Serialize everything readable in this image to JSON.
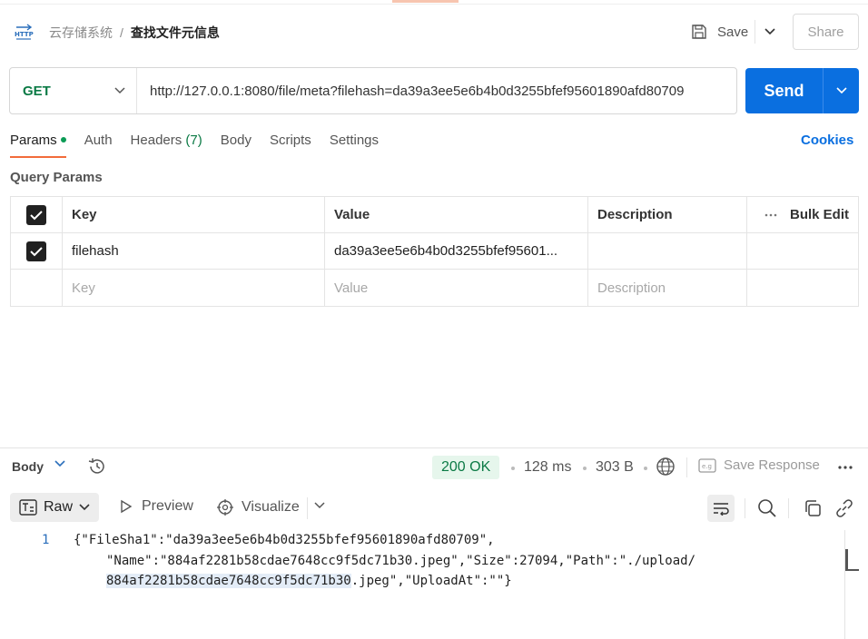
{
  "colors": {
    "accent": "#f26b3a",
    "send": "#0a6fe0",
    "get": "#0b7a45",
    "status_ok_bg": "#e6f6ec"
  },
  "header": {
    "icon": "http-icon",
    "breadcrumb_parent": "云存储系统",
    "breadcrumb_sep": "/",
    "title": "查找文件元信息",
    "save_label": "Save",
    "share_label": "Share"
  },
  "request": {
    "method": "GET",
    "url": "http://127.0.0.1:8080/file/meta?filehash=da39a3ee5e6b4b0d3255bfef95601890afd80709",
    "send_label": "Send"
  },
  "tabs": {
    "params": "Params",
    "auth": "Auth",
    "headers": "Headers",
    "headers_count": "(7)",
    "body": "Body",
    "scripts": "Scripts",
    "settings": "Settings",
    "cookies": "Cookies"
  },
  "query_params": {
    "title": "Query Params",
    "headers": {
      "key": "Key",
      "value": "Value",
      "description": "Description",
      "bulk_edit": "Bulk Edit"
    },
    "rows": [
      {
        "checked": true,
        "key": "filehash",
        "value": "da39a3ee5e6b4b0d3255bfef95601...",
        "description": ""
      }
    ],
    "placeholder": {
      "key": "Key",
      "value": "Value",
      "description": "Description"
    }
  },
  "response": {
    "body_label": "Body",
    "status": "200 OK",
    "time": "128 ms",
    "size": "303 B",
    "save_response": "Save Response",
    "format": "Raw",
    "preview": "Preview",
    "visualize": "Visualize",
    "line_number": "1",
    "code_lines": [
      "{\"FileSha1\":\"da39a3ee5e6b4b0d3255bfef95601890afd80709\",",
      "\"Name\":\"884af2281b58cdae7648cc9f5dc71b30.jpeg\",\"Size\":27094,\"Path\":\"./upload/",
      "884af2281b58cdae7648cc9f5dc71b30",
      ".jpeg\",\"UploadAt\":\"\"}"
    ]
  }
}
